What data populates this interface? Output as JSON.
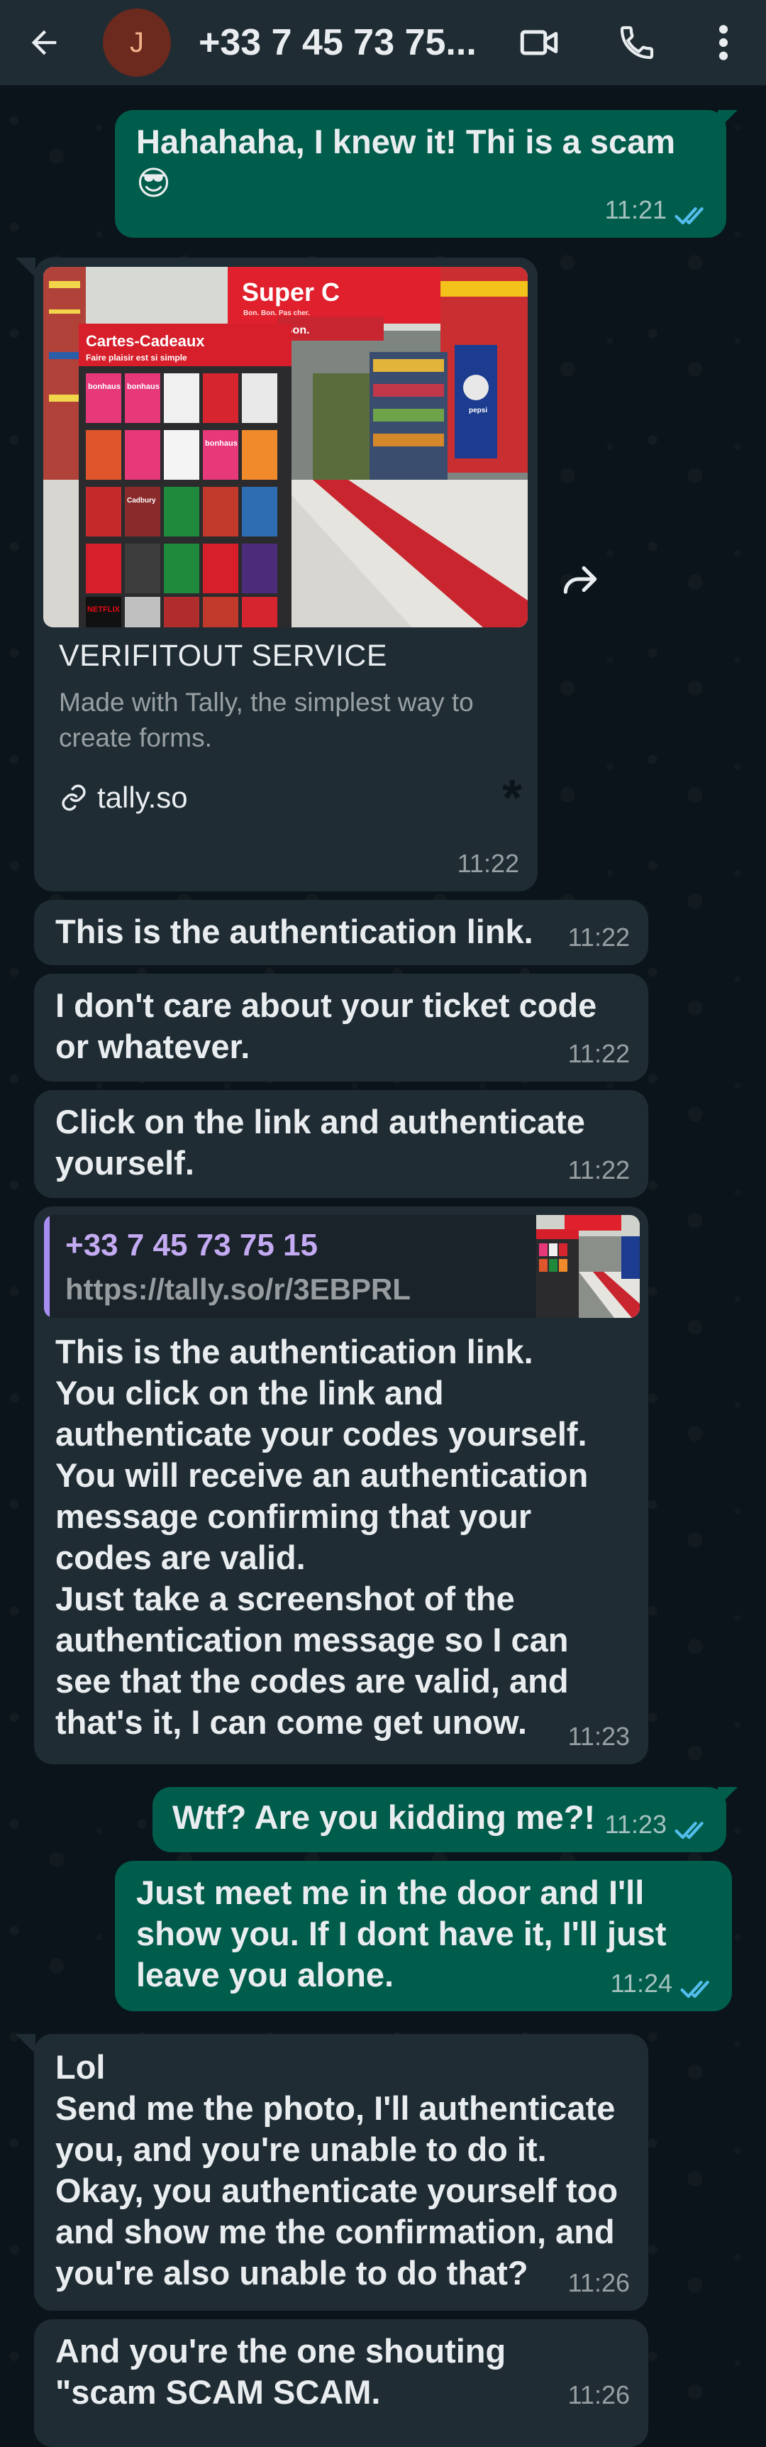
{
  "header": {
    "avatar_initial": "J",
    "title": "+33 7 45 73 75...",
    "icons": [
      "back-arrow-icon",
      "video-call-icon",
      "phone-icon",
      "more-options-icon"
    ]
  },
  "colors": {
    "outgoing_bubble": "#005c4b",
    "incoming_bubble": "#1f2c34",
    "read_ticks": "#53bdeb",
    "quote_accent": "#a88ef0",
    "background": "#0b141a"
  },
  "messages": [
    {
      "direction": "out",
      "text": "Hahahaha, I knew it! Thi is a scam 😎",
      "time": "11:21",
      "status": "read"
    },
    {
      "direction": "in",
      "type": "link-preview",
      "link_title": "VERIFITOUT SERVICE",
      "link_description": "Made with Tally, the simplest way to create forms.",
      "link_domain": "tally.so",
      "time": "11:22",
      "image_signs": {
        "store": "Super C",
        "store_tag": "Bon. Bon. Pas cher.",
        "gift_cards": "Cartes-Cadeaux",
        "gift_cards_sub": "Faire plaisir est si simple",
        "aisle": "Bon.",
        "brand": "pepsi",
        "cards": [
          "bonhaus",
          "bonhaus",
          "bonhaus",
          "NETFLIX",
          "Cadbury"
        ]
      }
    },
    {
      "direction": "in",
      "text": "This is the authentication link.",
      "time": "11:22"
    },
    {
      "direction": "in",
      "text": "I don't care about your ticket code or whatever.",
      "time": "11:22"
    },
    {
      "direction": "in",
      "text": "Click on the link and authenticate yourself.",
      "time": "11:22"
    },
    {
      "direction": "in",
      "type": "reply",
      "quote_name": "+33 7 45 73 75 15",
      "quote_text": "https://tally.so/r/3EBPRL",
      "text": "This is the authentication link.\nYou click on the link and authenticate your codes yourself. You will receive an authentication message confirming that your codes are valid.\nJust take a screenshot of the authentication message so I can see that the codes are valid, and that's it, I can come get unow.",
      "time": "11:23"
    },
    {
      "direction": "out",
      "text": "Wtf? Are you kidding me?!",
      "time": "11:23",
      "status": "read"
    },
    {
      "direction": "out",
      "text": "Just meet me in the door and I'll show you. If I dont have it, I'll just leave you alone.",
      "time": "11:24",
      "status": "read"
    },
    {
      "direction": "in",
      "text": "Lol\nSend me the photo, I'll authenticate you, and you're unable to do it. Okay, you authenticate yourself too and show me the confirmation, and you're also unable to do that?",
      "time": "11:26"
    },
    {
      "direction": "in",
      "text": "And you're the one shouting \"scam SCAM SCAM.",
      "time": "11:26"
    }
  ]
}
